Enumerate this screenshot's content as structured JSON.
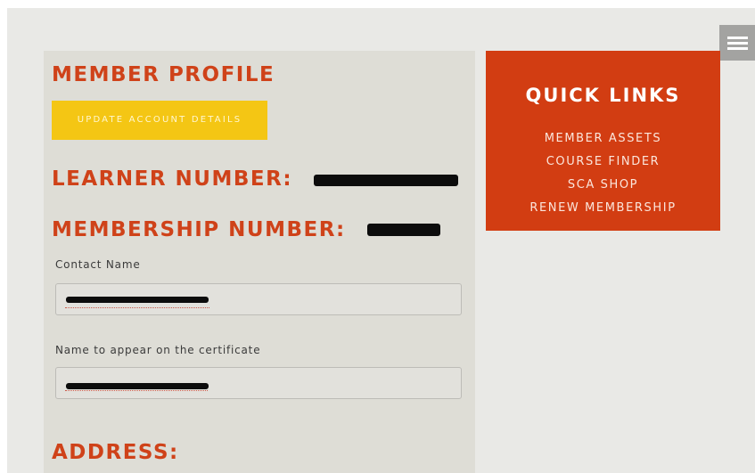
{
  "nav": {
    "menu_icon": "hamburger-menu-icon"
  },
  "profile": {
    "title": "MEMBER PROFILE",
    "update_button": "UPDATE ACCOUNT DETAILS",
    "learner_number_label": "LEARNER NUMBER:",
    "membership_number_label": "MEMBERSHIP NUMBER:",
    "contact_name_label": "Contact Name",
    "certificate_name_label": "Name to appear on the certificate",
    "address_heading": "ADDRESS:"
  },
  "quick_links": {
    "title": "QUICK LINKS",
    "items": [
      "MEMBER ASSETS",
      "COURSE FINDER",
      "SCA SHOP",
      "RENEW MEMBERSHIP"
    ]
  },
  "colors": {
    "accent_red": "#d23d12",
    "heading_red": "#cf4219",
    "button_yellow": "#f4c614",
    "panel_beige": "#deddd6",
    "page_bg": "#e9e9e6"
  }
}
